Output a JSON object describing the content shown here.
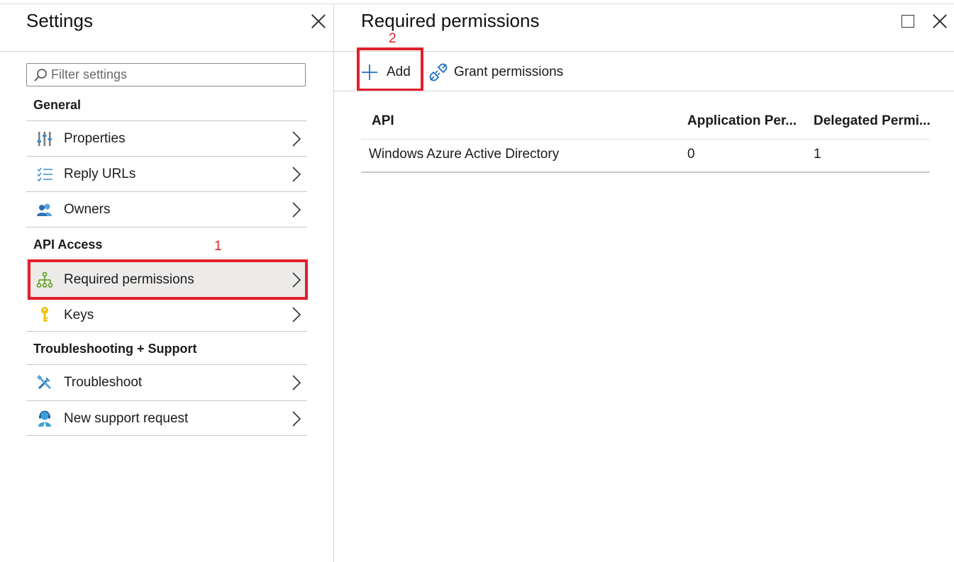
{
  "settings": {
    "title": "Settings",
    "filter_placeholder": "Filter settings",
    "sections": [
      {
        "heading": "General",
        "items": [
          {
            "label": "Properties"
          },
          {
            "label": "Reply URLs"
          },
          {
            "label": "Owners"
          }
        ]
      },
      {
        "heading": "API Access",
        "items": [
          {
            "label": "Required permissions",
            "selected": true
          },
          {
            "label": "Keys"
          }
        ]
      },
      {
        "heading": "Troubleshooting + Support",
        "items": [
          {
            "label": "Troubleshoot"
          },
          {
            "label": "New support request"
          }
        ]
      }
    ]
  },
  "permissions": {
    "title": "Required permissions",
    "toolbar": {
      "add_label": "Add",
      "grant_label": "Grant permissions"
    },
    "table": {
      "columns": [
        "API",
        "Application Per...",
        "Delegated Permi..."
      ],
      "rows": [
        [
          "Windows Azure Active Directory",
          "0",
          "1"
        ]
      ]
    }
  },
  "annotations": {
    "step1": "1",
    "step2": "2",
    "color": "#e0202b"
  },
  "icons": {
    "properties": "properties-sliders-icon",
    "reply_urls": "checklist-icon",
    "owners": "people-icon",
    "required_permissions": "hierarchy-icon",
    "keys": "key-icon",
    "troubleshoot": "tools-icon",
    "support": "support-person-icon",
    "add": "plus-icon",
    "grant": "plug-icon"
  }
}
